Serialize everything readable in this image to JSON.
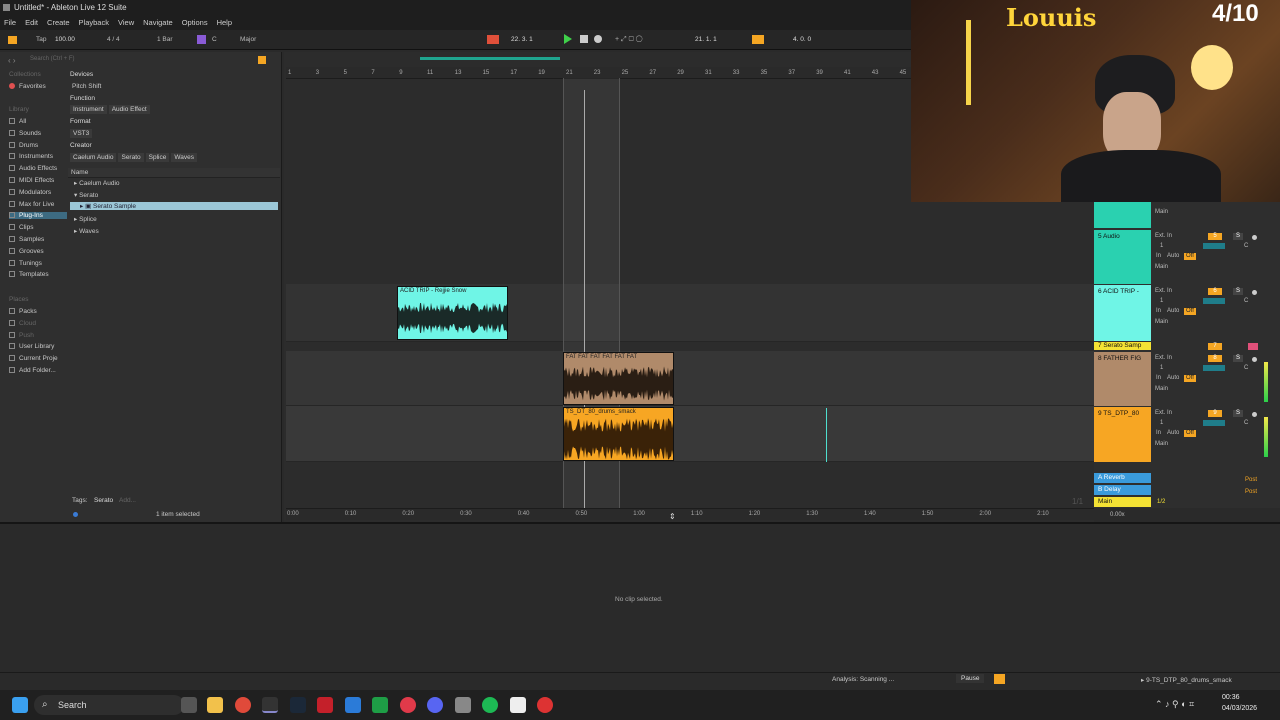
{
  "window": {
    "title": "Untitled* - Ableton Live 12 Suite"
  },
  "menu": [
    "File",
    "Edit",
    "Create",
    "Playback",
    "View",
    "Navigate",
    "Options",
    "Help"
  ],
  "transport": {
    "tap": "Tap",
    "bpm": "100.00",
    "sig": "4 / 4",
    "quant": "1 Bar",
    "key": "C",
    "scale": "Major",
    "position": "22.   3.   1",
    "loop_start": "21.   1.   1",
    "loop_len": "4.   0.   0"
  },
  "browser": {
    "search_placeholder": "Search (Ctrl + F)",
    "collections_label": "Collections",
    "favorites": "Favorites",
    "library_label": "Library",
    "library_items": [
      "All",
      "Sounds",
      "Drums",
      "Instruments",
      "Audio Effects",
      "MIDI Effects",
      "Modulators",
      "Max for Live",
      "Plug-Ins",
      "Clips",
      "Samples",
      "Grooves",
      "Tunings",
      "Templates"
    ],
    "places_label": "Places",
    "places_items": [
      "Packs",
      "Cloud",
      "Push",
      "User Library",
      "Current Proje",
      "Add Folder..."
    ],
    "filters": {
      "devices": "Devices",
      "devices_val": "Pitch Shift",
      "function": "Function",
      "function_tags": [
        "Instrument",
        "Audio Effect"
      ],
      "format": "Format",
      "format_val": "VST3",
      "creator": "Creator",
      "creator_tags": [
        "Caelum Audio",
        "Serato",
        "Splice",
        "Waves"
      ]
    },
    "name_header": "Name",
    "tree": [
      "Caelum Audio",
      "Serato",
      "Serato Sample",
      "Splice",
      "Waves"
    ],
    "tags_label": "Tags:",
    "tags_val": "Serato",
    "tags_add": "Add...",
    "selection": "1 item selected"
  },
  "ruler": [
    "1",
    "3",
    "5",
    "7",
    "9",
    "11",
    "13",
    "15",
    "17",
    "19",
    "21",
    "23",
    "25",
    "27",
    "29",
    "31",
    "33",
    "35",
    "37",
    "39",
    "41",
    "43",
    "45"
  ],
  "time_ruler": [
    "0:00",
    "0:10",
    "0:20",
    "0:30",
    "0:40",
    "0:50",
    "1:00",
    "1:10",
    "1:20",
    "1:30",
    "1:40",
    "1:50",
    "2:00",
    "2:10"
  ],
  "clips": {
    "acid": "ACID TRIP - Rejjie Snow",
    "father": "FAT FAT FAT FAT FAT FAT",
    "drums": "TS_DT_80_drums_smack"
  },
  "tracks": [
    {
      "name": "5 Audio",
      "num": "5",
      "color": "#2ad1b0"
    },
    {
      "name": "6 ACID TRIP -",
      "num": "6",
      "color": "#6ff5e6"
    },
    {
      "name": "7 Serato Samp",
      "num": "7",
      "color": "#f4e234"
    },
    {
      "name": "8 FATHER FIG",
      "num": "8",
      "color": "#b08a6a"
    },
    {
      "name": "9 TS_DTP_80",
      "num": "9",
      "color": "#f7a623"
    }
  ],
  "io": {
    "ext_in": "Ext. In",
    "in": "In",
    "auto": "Auto",
    "off": "Off",
    "main": "Main",
    "s": "S",
    "c": "C",
    "one": "1"
  },
  "returns": [
    {
      "name": "A Reverb",
      "color": "#3a9bdc"
    },
    {
      "name": "B Delay",
      "color": "#3a9bdc"
    },
    {
      "name": "Main",
      "color": "#f4e234"
    }
  ],
  "main_extra": {
    "ratio": "1/1",
    "half": "1/2",
    "post": "Post",
    "pct": "0.00x"
  },
  "detail": {
    "empty": "No clip selected."
  },
  "status": {
    "analysis": "Analysis: Scanning ...",
    "pause": "Pause",
    "track": "9-TS_DTP_80_drums_smack"
  },
  "taskbar": {
    "search": "Search",
    "time": "00:36",
    "date": "04/03/2026"
  },
  "overlay": {
    "name": "Louuis",
    "score": "4/10"
  }
}
